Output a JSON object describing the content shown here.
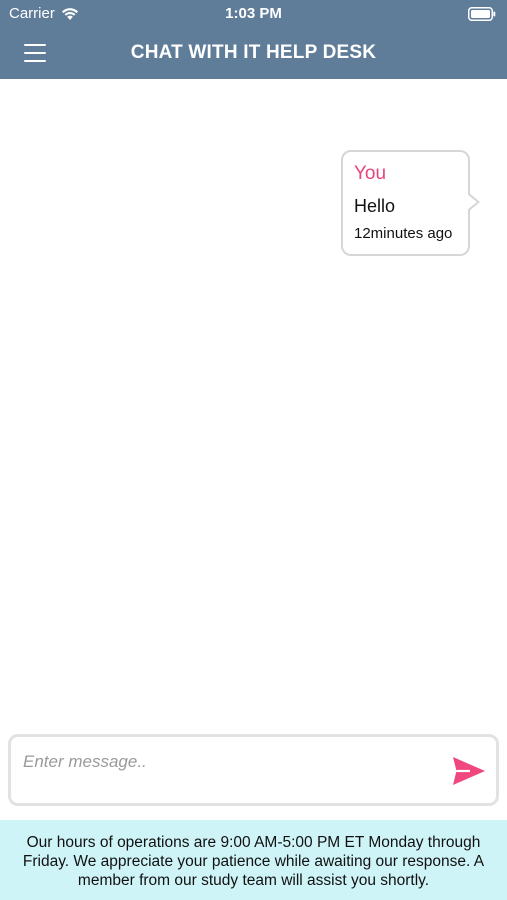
{
  "status_bar": {
    "carrier": "Carrier",
    "time": "1:03 PM"
  },
  "navbar": {
    "title": "CHAT WITH IT HELP DESK",
    "menu_icon": "hamburger-menu-icon",
    "background_color": "#5f7d99"
  },
  "messages": [
    {
      "sender": "You",
      "text": "Hello",
      "time": "12minutes ago"
    }
  ],
  "composer": {
    "placeholder": "Enter message..",
    "value": "",
    "send_icon": "send-icon",
    "accent_color": "#f0477f"
  },
  "info_banner": {
    "text": "Our hours of operations are 9:00 AM-5:00 PM ET Monday through Friday. We appreciate your patience while awaiting our response. A member from our study team will assist you shortly.",
    "background_color": "#cff4f8"
  }
}
